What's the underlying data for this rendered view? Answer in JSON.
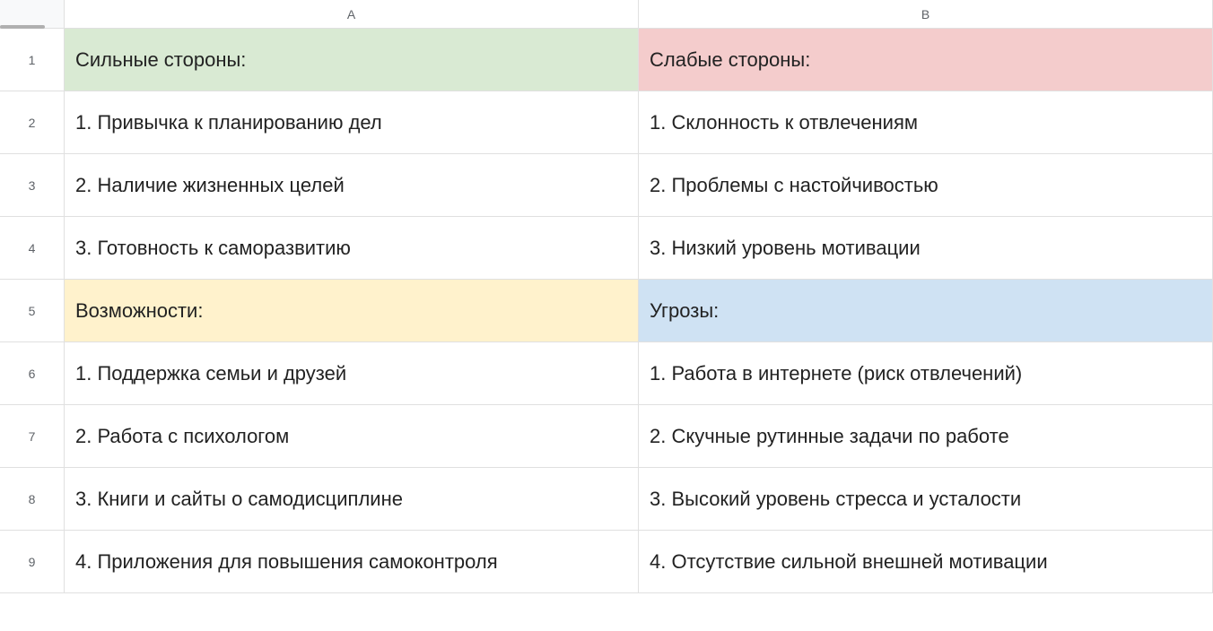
{
  "columns": [
    "A",
    "B"
  ],
  "rowNumbers": [
    "1",
    "2",
    "3",
    "4",
    "5",
    "6",
    "7",
    "8",
    "9"
  ],
  "rows": [
    {
      "type": "header",
      "cells": [
        {
          "text": "Сильные стороны:",
          "bg": "green"
        },
        {
          "text": "Слабые стороны:",
          "bg": "pink"
        }
      ]
    },
    {
      "type": "data",
      "cells": [
        {
          "text": "1. Привычка к планированию дел",
          "bg": ""
        },
        {
          "text": "1. Склонность к отвлечениям",
          "bg": ""
        }
      ]
    },
    {
      "type": "data",
      "cells": [
        {
          "text": "2. Наличие жизненных целей",
          "bg": ""
        },
        {
          "text": "2. Проблемы с настойчивостью",
          "bg": ""
        }
      ]
    },
    {
      "type": "data",
      "cells": [
        {
          "text": "3. Готовность к саморазвитию",
          "bg": ""
        },
        {
          "text": "3. Низкий уровень мотивации",
          "bg": ""
        }
      ]
    },
    {
      "type": "header",
      "cells": [
        {
          "text": "Возможности:",
          "bg": "yellow"
        },
        {
          "text": "Угрозы:",
          "bg": "blue"
        }
      ]
    },
    {
      "type": "data",
      "cells": [
        {
          "text": "1. Поддержка семьи и друзей",
          "bg": ""
        },
        {
          "text": "1. Работа в интернете (риск отвлечений)",
          "bg": ""
        }
      ]
    },
    {
      "type": "data",
      "cells": [
        {
          "text": "2. Работа с психологом",
          "bg": ""
        },
        {
          "text": "2. Скучные рутинные задачи по работе",
          "bg": ""
        }
      ]
    },
    {
      "type": "data",
      "cells": [
        {
          "text": "3. Книги и сайты о самодисциплине",
          "bg": ""
        },
        {
          "text": "3. Высокий уровень стресса и усталости",
          "bg": ""
        }
      ]
    },
    {
      "type": "data",
      "cells": [
        {
          "text": "4. Приложения для повышения самоконтроля",
          "bg": ""
        },
        {
          "text": "4. Отсутствие сильной внешней мотивации",
          "bg": ""
        }
      ]
    }
  ],
  "colors": {
    "green": "#d9ead3",
    "pink": "#f4cccc",
    "yellow": "#fff2cc",
    "blue": "#cfe2f3"
  }
}
